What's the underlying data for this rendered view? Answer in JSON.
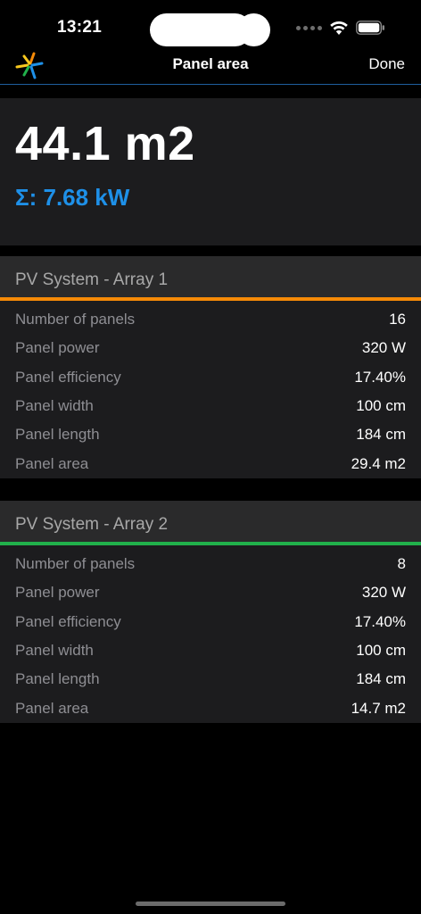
{
  "status_bar": {
    "time": "13:21"
  },
  "nav": {
    "title": "Panel area",
    "done_label": "Done"
  },
  "summary": {
    "area": "44.1 m2",
    "power": "Σ: 7.68 kW"
  },
  "arrays": [
    {
      "title": "PV System - Array 1",
      "accent_color": "#f58a07",
      "rows": [
        {
          "label": "Number of panels",
          "value": "16"
        },
        {
          "label": "Panel power",
          "value": "320 W"
        },
        {
          "label": "Panel efficiency",
          "value": "17.40%"
        },
        {
          "label": "Panel width",
          "value": "100 cm"
        },
        {
          "label": "Panel length",
          "value": "184 cm"
        },
        {
          "label": "Panel area",
          "value": "29.4 m2"
        }
      ]
    },
    {
      "title": "PV System - Array 2",
      "accent_color": "#21b04b",
      "rows": [
        {
          "label": "Number of panels",
          "value": "8"
        },
        {
          "label": "Panel power",
          "value": "320 W"
        },
        {
          "label": "Panel efficiency",
          "value": "17.40%"
        },
        {
          "label": "Panel width",
          "value": "100 cm"
        },
        {
          "label": "Panel length",
          "value": "184 cm"
        },
        {
          "label": "Panel area",
          "value": "14.7 m2"
        }
      ]
    }
  ],
  "colors": {
    "accent_blue": "#1e90e8",
    "nav_divider": "#1f5f9e",
    "card_bg": "#1c1c1e"
  },
  "icons": {
    "logo": "solar-burst-logo-icon",
    "signal": "cellular-signal-icon",
    "wifi": "wifi-icon",
    "battery": "battery-icon"
  }
}
